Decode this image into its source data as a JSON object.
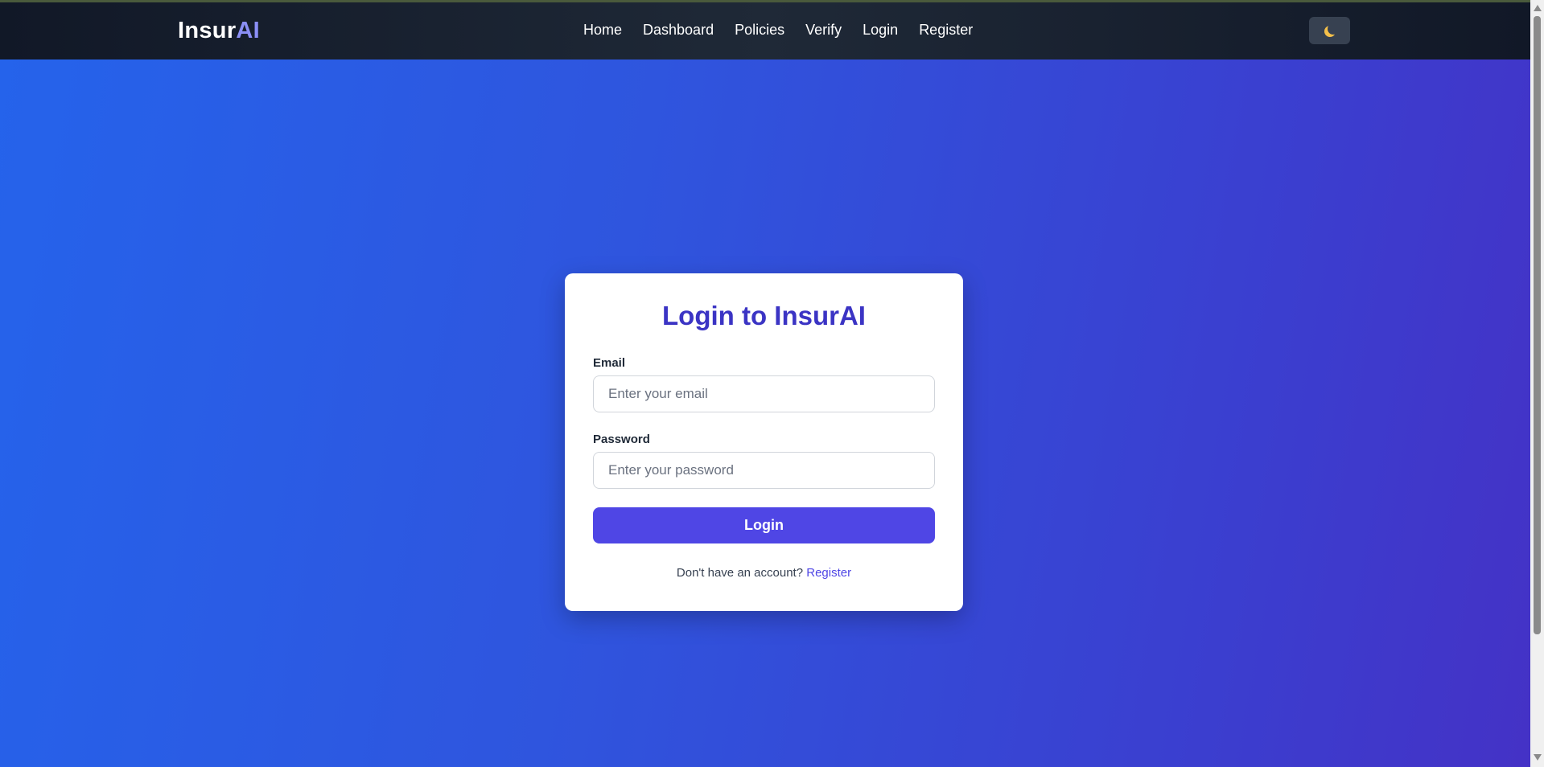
{
  "navbar": {
    "brand_main": "Insur",
    "brand_accent": "AI",
    "links": [
      "Home",
      "Dashboard",
      "Policies",
      "Verify",
      "Login",
      "Register"
    ],
    "theme_toggle_icon": "moon-icon"
  },
  "login_card": {
    "title": "Login to InsurAI",
    "email_label": "Email",
    "email_placeholder": "Enter your email",
    "email_value": "",
    "password_label": "Password",
    "password_placeholder": "Enter your password",
    "password_value": "",
    "submit_label": "Login",
    "footer_prompt": "Don't have an account?",
    "footer_link": "Register"
  },
  "colors": {
    "navbar_bg": "#1f2937",
    "brand_accent": "#8b8ff5",
    "hero_gradient_start": "#2563eb",
    "hero_gradient_end": "#4432c6",
    "title": "#3b34c4",
    "button": "#4f46e5",
    "link": "#4f46e5"
  }
}
